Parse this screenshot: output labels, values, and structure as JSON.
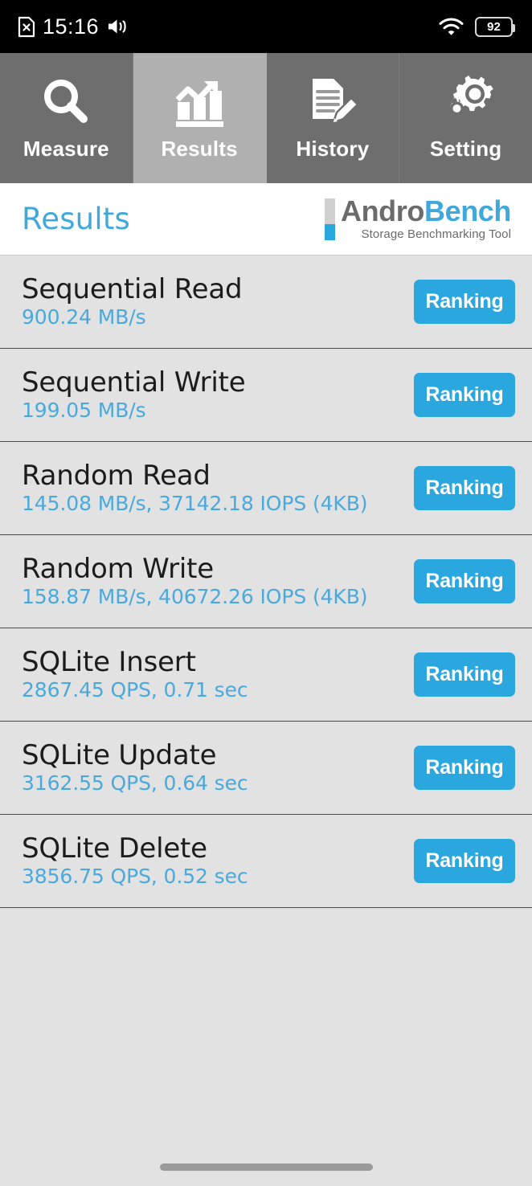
{
  "statusbar": {
    "time": "15:16",
    "battery_level": "92",
    "icons": [
      "sim-off-icon",
      "volume-icon",
      "wifi-icon",
      "battery-icon"
    ]
  },
  "tabs": [
    {
      "label": "Measure",
      "icon": "magnifier-icon",
      "active": false
    },
    {
      "label": "Results",
      "icon": "bar-chart-up-icon",
      "active": true
    },
    {
      "label": "History",
      "icon": "document-pencil-icon",
      "active": false
    },
    {
      "label": "Setting",
      "icon": "gears-icon",
      "active": false
    }
  ],
  "header": {
    "title": "Results",
    "logo_primary": "Andro",
    "logo_secondary": "Bench",
    "logo_subtitle": "Storage Benchmarking Tool"
  },
  "results": [
    {
      "name": "Sequential Read",
      "value": "900.24 MB/s",
      "action": "Ranking"
    },
    {
      "name": "Sequential Write",
      "value": "199.05 MB/s",
      "action": "Ranking"
    },
    {
      "name": "Random Read",
      "value": "145.08 MB/s, 37142.18 IOPS (4KB)",
      "action": "Ranking"
    },
    {
      "name": "Random Write",
      "value": "158.87 MB/s, 40672.26 IOPS (4KB)",
      "action": "Ranking"
    },
    {
      "name": "SQLite Insert",
      "value": "2867.45 QPS, 0.71 sec",
      "action": "Ranking"
    },
    {
      "name": "SQLite Update",
      "value": "3162.55 QPS, 0.64 sec",
      "action": "Ranking"
    },
    {
      "name": "SQLite Delete",
      "value": "3856.75 QPS, 0.52 sec",
      "action": "Ranking"
    }
  ],
  "colors": {
    "accent_blue": "#2ba7e0",
    "title_blue": "#41a8dc",
    "value_blue": "#4aa9dc",
    "tab_inactive": "#6e6e6e",
    "tab_active": "#b0b0b0",
    "list_bg": "#e2e2e2"
  }
}
